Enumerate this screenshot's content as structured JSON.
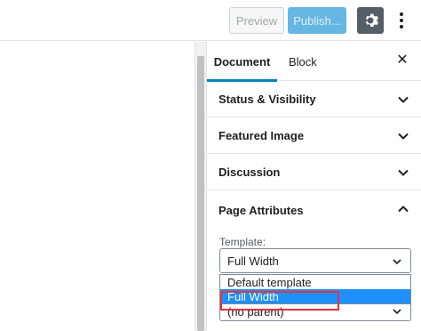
{
  "toolbar": {
    "preview_label": "Preview",
    "publish_label": "Publish...",
    "settings_icon": "gear-icon",
    "more_icon": "more-vertical-icon"
  },
  "sidebar": {
    "tabs": [
      {
        "label": "Document"
      },
      {
        "label": "Block"
      }
    ],
    "close_icon": "close-icon",
    "panels": [
      {
        "title": "Status & Visibility"
      },
      {
        "title": "Featured Image"
      },
      {
        "title": "Discussion"
      }
    ],
    "page_attributes": {
      "title": "Page Attributes",
      "template_label": "Template:",
      "template_value": "Full Width",
      "options": [
        "Default template",
        "Full Width"
      ],
      "parent_value": "(no parent)"
    }
  },
  "colors": {
    "accent": "#0085ba",
    "publish_bg": "#66b6e4",
    "settings_bg": "#555d66",
    "option_selected": "#1e90ff",
    "highlight": "#e8323c"
  }
}
